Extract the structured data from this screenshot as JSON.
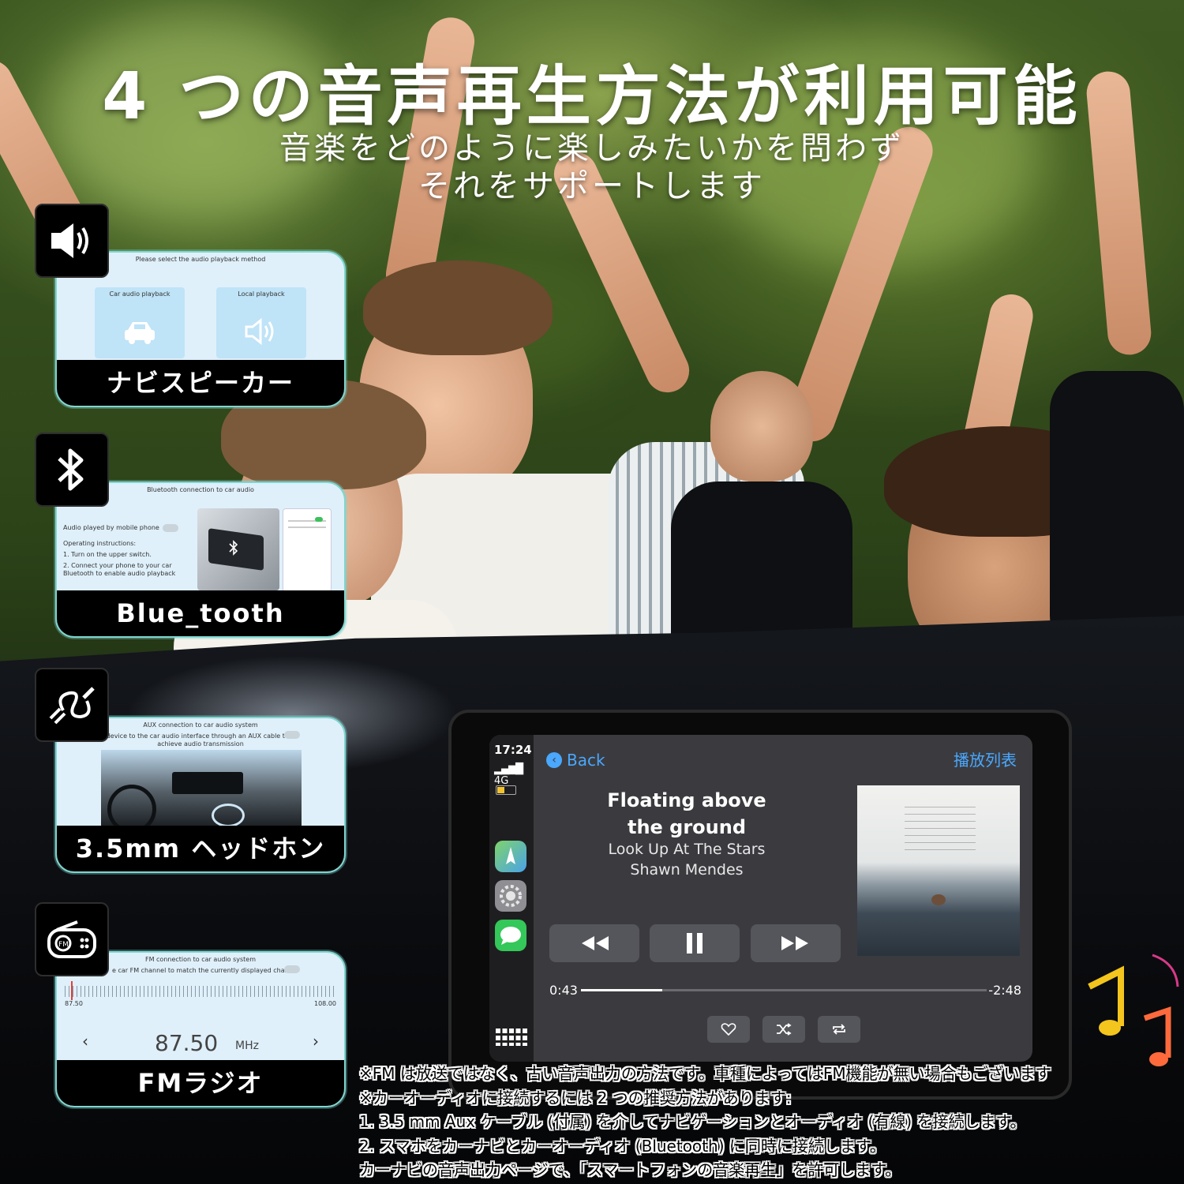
{
  "headline": {
    "title": "4 つの音声再生方法が利用可能",
    "subtitle_line1": "音楽をどのように楽しみたいかを問わず",
    "subtitle_line2": "それをサポートします"
  },
  "features": {
    "navi_speaker": {
      "label": "ナビスピーカー",
      "icon": "speaker-icon",
      "screen_title": "Please select the audio playback method",
      "option1": "Car audio playback",
      "option2": "Local playback"
    },
    "bluetooth": {
      "label": "Blue_tooth",
      "icon": "bluetooth-icon",
      "screen_title": "Bluetooth connection to car audio",
      "toggle_label": "Audio played by mobile phone",
      "instructions_title": "Operating instructions:",
      "step1": "1. Turn on the upper switch.",
      "step2": "2. Connect your phone to your car",
      "step2b": "Bluetooth to enable audio playback"
    },
    "aux": {
      "label": "3.5mm ヘッドホン",
      "icon": "aux-cable-icon",
      "screen_title": "AUX connection to car audio system",
      "desc1": "s device to the car audio interface through an AUX cable to",
      "desc2": "achieve audio transmission"
    },
    "fm": {
      "label": "FMラジオ",
      "icon": "radio-icon",
      "screen_title": "FM connection to car audio system",
      "desc": "e car FM channel to match the currently displayed channel",
      "range_min": "87.50",
      "range_max": "108.00",
      "frequency": "87.50",
      "unit": "MHz"
    }
  },
  "player": {
    "time": "17:24",
    "network": "4G",
    "back_label": "Back",
    "playlist_label": "播放列表",
    "title_line1": "Floating above",
    "title_line2": "the ground",
    "album": "Look Up At The Stars",
    "artist": "Shawn Mendes",
    "elapsed": "0:43",
    "remaining": "-2:48",
    "progress": 0.2,
    "accent": "#4aa8ff"
  },
  "notes": {
    "line1": "※FM は放送ではなく、古い音声出力の方法です。車種によってはFM機能が無い場合もございます",
    "line2": "※カーオーディオに接続するには 2 つの推奨方法があります:",
    "line3": "1. 3.5 mm Aux ケーブル (付属) を介してナビゲーションとオーディオ (有線) を接続します。",
    "line4": "2. スマホをカーナビとカーオーディオ (Bluetooth) に同時に接続します。",
    "line5": "カーナビの音声出力ページで、「スマートフォンの音楽再生」を許可します。"
  }
}
